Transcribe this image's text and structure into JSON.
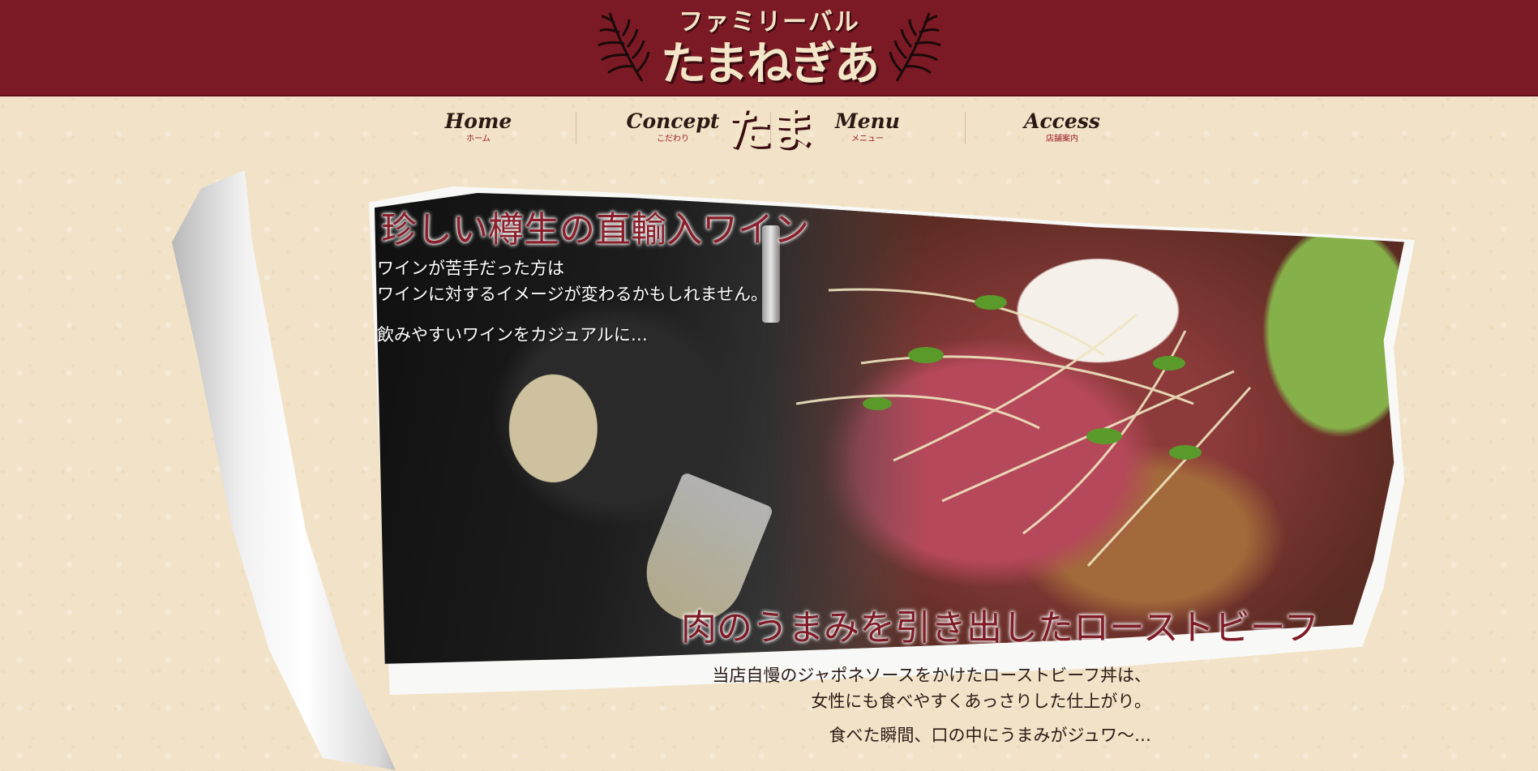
{
  "header": {
    "logo_subtitle": "ファミリーバル",
    "logo_title": "たまねぎあたま"
  },
  "nav": {
    "items": [
      {
        "en": "Home",
        "jp": "ホーム"
      },
      {
        "en": "Concept",
        "jp": "こだわり"
      },
      {
        "en": "Menu",
        "jp": "メニュー"
      },
      {
        "en": "Access",
        "jp": "店舗案内"
      }
    ]
  },
  "hero": {
    "wine": {
      "title": "珍しい樽生の直輸入ワイン",
      "line1": "ワインが苦手だった方は",
      "line2": "ワインに対するイメージが変わるかもしれません。",
      "line3": "飲みやすいワインをカジュアルに…"
    },
    "beef": {
      "title": "肉のうまみを引き出したローストビーフ",
      "line1": "当店自慢のジャポネソースをかけたローストビーフ丼は、",
      "line2": "女性にも食べやすくあっさりした仕上がり。",
      "line3": "食べた瞬間、口の中にうまみがジュワ〜…"
    }
  },
  "colors": {
    "header_bg": "#7b1a24",
    "accent_red": "#8a1f2b",
    "page_bg": "#f2e3c8"
  }
}
